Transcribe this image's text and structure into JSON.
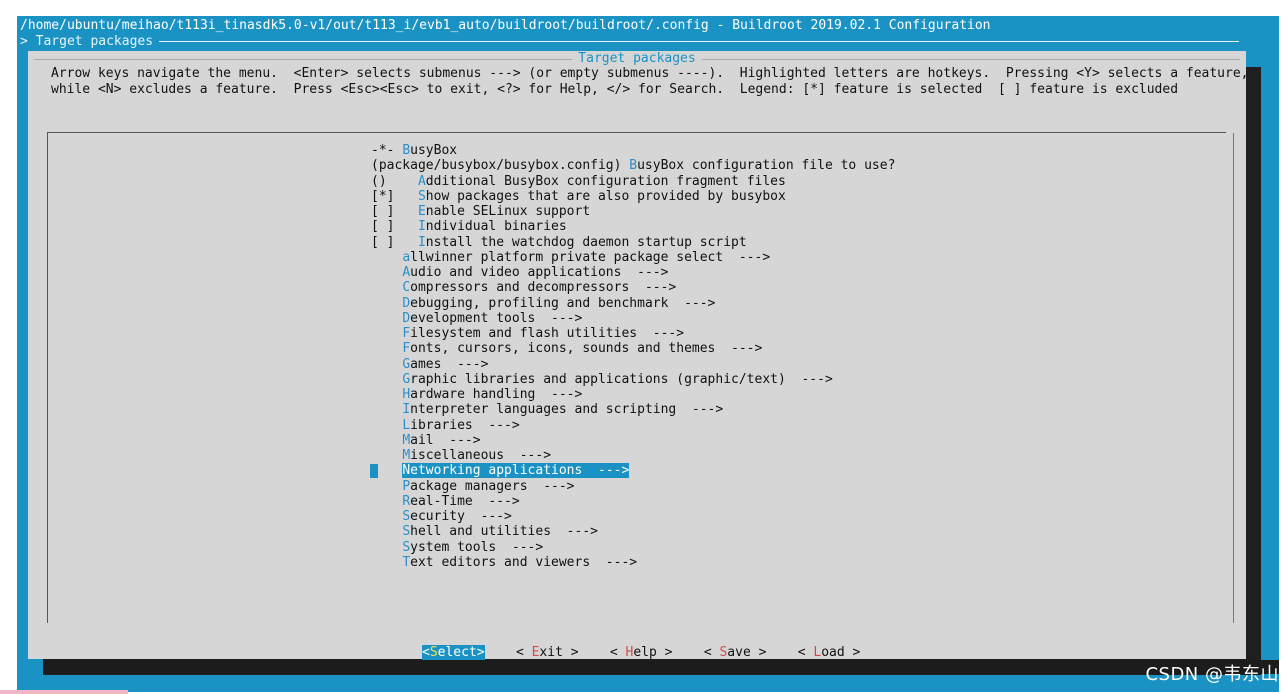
{
  "terminal": {
    "title": "/home/ubuntu/meihao/t113i_tinasdk5.0-v1/out/t113_i/evb1_auto/buildroot/buildroot/.config - Buildroot 2019.02.1 Configuration",
    "breadcrumb": "> Target packages"
  },
  "dialog": {
    "title": "Target packages",
    "help_line1": "Arrow keys navigate the menu.  <Enter> selects submenus ---> (or empty submenus ----).  Highlighted letters are hotkeys.  Pressing <Y> selects a feature,",
    "help_line2": "while <N> excludes a feature.  Press <Esc><Esc> to exit, <?> for Help, </> for Search.  Legend: [*] feature is selected  [ ] feature is excluded"
  },
  "menu": {
    "items": [
      {
        "prefix": "-*- ",
        "hotkey": "B",
        "rest": "usyBox"
      },
      {
        "prefix": "(package/busybox/busybox.config) ",
        "hotkey": "B",
        "rest": "usyBox configuration file to use?"
      },
      {
        "prefix": "()    ",
        "hotkey": "A",
        "rest": "dditional BusyBox configuration fragment files"
      },
      {
        "prefix": "[*]   ",
        "hotkey": "S",
        "rest": "how packages that are also provided by busybox"
      },
      {
        "prefix": "[ ]   ",
        "hotkey": "E",
        "rest": "nable SELinux support"
      },
      {
        "prefix": "[ ]   ",
        "hotkey": "I",
        "rest": "ndividual binaries"
      },
      {
        "prefix": "[ ]   ",
        "hotkey": "I",
        "rest": "nstall the watchdog daemon startup script"
      },
      {
        "prefix": "    ",
        "hotkey": "a",
        "rest": "llwinner platform private package select  --->"
      },
      {
        "prefix": "    ",
        "hotkey": "A",
        "rest": "udio and video applications  --->"
      },
      {
        "prefix": "    ",
        "hotkey": "C",
        "rest": "ompressors and decompressors  --->"
      },
      {
        "prefix": "    ",
        "hotkey": "D",
        "rest": "ebugging, profiling and benchmark  --->"
      },
      {
        "prefix": "    ",
        "hotkey": "D",
        "rest": "evelopment tools  --->"
      },
      {
        "prefix": "    ",
        "hotkey": "F",
        "rest": "ilesystem and flash utilities  --->"
      },
      {
        "prefix": "    ",
        "hotkey": "F",
        "rest": "onts, cursors, icons, sounds and themes  --->"
      },
      {
        "prefix": "    ",
        "hotkey": "G",
        "rest": "ames  --->"
      },
      {
        "prefix": "    ",
        "hotkey": "G",
        "rest": "raphic libraries and applications (graphic/text)  --->"
      },
      {
        "prefix": "    ",
        "hotkey": "H",
        "rest": "ardware handling  --->"
      },
      {
        "prefix": "    ",
        "hotkey": "I",
        "rest": "nterpreter languages and scripting  --->"
      },
      {
        "prefix": "    ",
        "hotkey": "L",
        "rest": "ibraries  --->"
      },
      {
        "prefix": "    ",
        "hotkey": "M",
        "rest": "ail  --->"
      },
      {
        "prefix": "    ",
        "hotkey": "M",
        "rest": "iscellaneous  --->"
      },
      {
        "prefix": "    ",
        "hotkey": "N",
        "rest": "etworking applications  --->",
        "selected": true
      },
      {
        "prefix": "    ",
        "hotkey": "P",
        "rest": "ackage managers  --->"
      },
      {
        "prefix": "    ",
        "hotkey": "R",
        "rest": "eal-Time  --->"
      },
      {
        "prefix": "    ",
        "hotkey": "S",
        "rest": "ecurity  --->"
      },
      {
        "prefix": "    ",
        "hotkey": "S",
        "rest": "hell and utilities  --->"
      },
      {
        "prefix": "    ",
        "hotkey": "S",
        "rest": "ystem tools  --->"
      },
      {
        "prefix": "    ",
        "hotkey": "T",
        "rest": "ext editors and viewers  --->"
      }
    ]
  },
  "buttons": {
    "select_open": "<",
    "select_hk": "S",
    "select_rest": "elect>",
    "exit_open": "< ",
    "exit_hk": "E",
    "exit_rest": "xit >",
    "help_open": "< ",
    "help_hk": "H",
    "help_rest": "elp >",
    "save_open": "< ",
    "save_hk": "S",
    "save_rest": "ave >",
    "load_open": "< ",
    "load_hk": "L",
    "load_rest": "oad >"
  },
  "watermark": "CSDN @韦东山",
  "colors": {
    "terminal_bg": "#1a93c4",
    "dialog_bg": "#d6d6d6",
    "hotkey": "#2d8fc8",
    "selection_bg": "#1a93c4",
    "button_hotkey": "#d94848"
  }
}
